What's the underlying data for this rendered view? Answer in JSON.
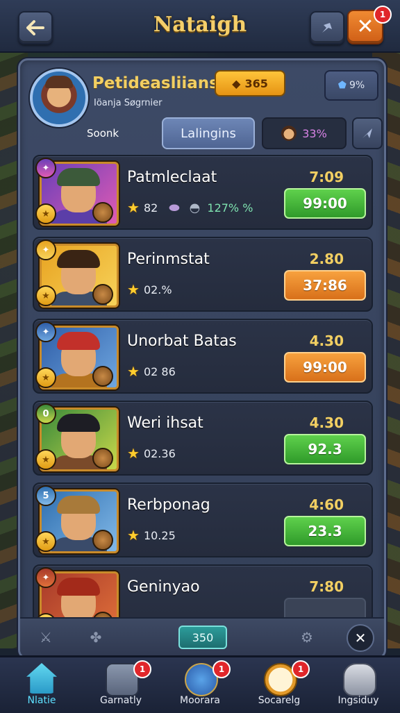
{
  "header": {
    "title": "Nataigh",
    "close_badge": "1"
  },
  "profile": {
    "name": "Petideasliians",
    "subtitle": "Iöanja Søgrnier",
    "gold": "365",
    "shield_value": "9%",
    "stat_label": "Soonk",
    "tab_label": "Lalingins",
    "percent": "33%"
  },
  "rows": [
    {
      "name": "Patmleclaat",
      "time": "7:09",
      "price": "99:00",
      "stat1": "82",
      "stat2": "127% %",
      "price_color": "green",
      "top_badge": "",
      "theme": [
        "#6a3fb8",
        "#e05bb4"
      ],
      "hair": "#3c5a3a",
      "body": "#5b3ea8"
    },
    {
      "name": "Perinmstat",
      "time": "2.80",
      "price": "37:86",
      "stat1": "02.%",
      "stat2": "",
      "price_color": "orange",
      "top_badge": "",
      "theme": [
        "#e8a321",
        "#f7d35a"
      ],
      "hair": "#3a2414",
      "body": "#3d4e6a"
    },
    {
      "name": "Unorbat Batas",
      "time": "4.30",
      "price": "99:00",
      "stat1": "02 86",
      "stat2": "",
      "price_color": "orange",
      "top_badge": "",
      "theme": [
        "#2f5ea8",
        "#6fa7e0"
      ],
      "hair": "#c2302a",
      "body": "#b4731f"
    },
    {
      "name": "Weri ihsat",
      "time": "4.30",
      "price": "92.3",
      "stat1": "02.36",
      "stat2": "",
      "price_color": "green",
      "top_badge": "0",
      "theme": [
        "#3a8a3a",
        "#c9d84a"
      ],
      "hair": "#1d1d24",
      "body": "#7a4a2a"
    },
    {
      "name": "Rerbponag",
      "time": "4:60",
      "price": "23.3",
      "stat1": "10.25",
      "stat2": "",
      "price_color": "green",
      "top_badge": "5",
      "theme": [
        "#2f6fb0",
        "#82b9e8"
      ],
      "hair": "#a87a3a",
      "body": "#3a4b6a"
    },
    {
      "name": "Geninyao",
      "time": "7:80",
      "price": "",
      "stat1": "",
      "stat2": "",
      "price_color": "gray",
      "top_badge": "",
      "theme": [
        "#a83a2a",
        "#e0703a"
      ],
      "hair": "#a32a1a",
      "body": "#6a2a2a"
    }
  ],
  "toolbar": {
    "counter": "350"
  },
  "nav": [
    {
      "label": "Nlatie",
      "icon": "home-icon",
      "badge": ""
    },
    {
      "label": "Garnatly",
      "icon": "gear-tools-icon",
      "badge": "1"
    },
    {
      "label": "Moorara",
      "icon": "globe-map-icon",
      "badge": "1"
    },
    {
      "label": "Socarelg",
      "icon": "clock-icon",
      "badge": "1"
    },
    {
      "label": "Ingsiduy",
      "icon": "cauldron-icon",
      "badge": ""
    }
  ],
  "colors": {
    "accent_gold": "#f2cf62",
    "green_button": "#3fb23a",
    "orange_button": "#e7821f",
    "badge_red": "#e0262a"
  }
}
